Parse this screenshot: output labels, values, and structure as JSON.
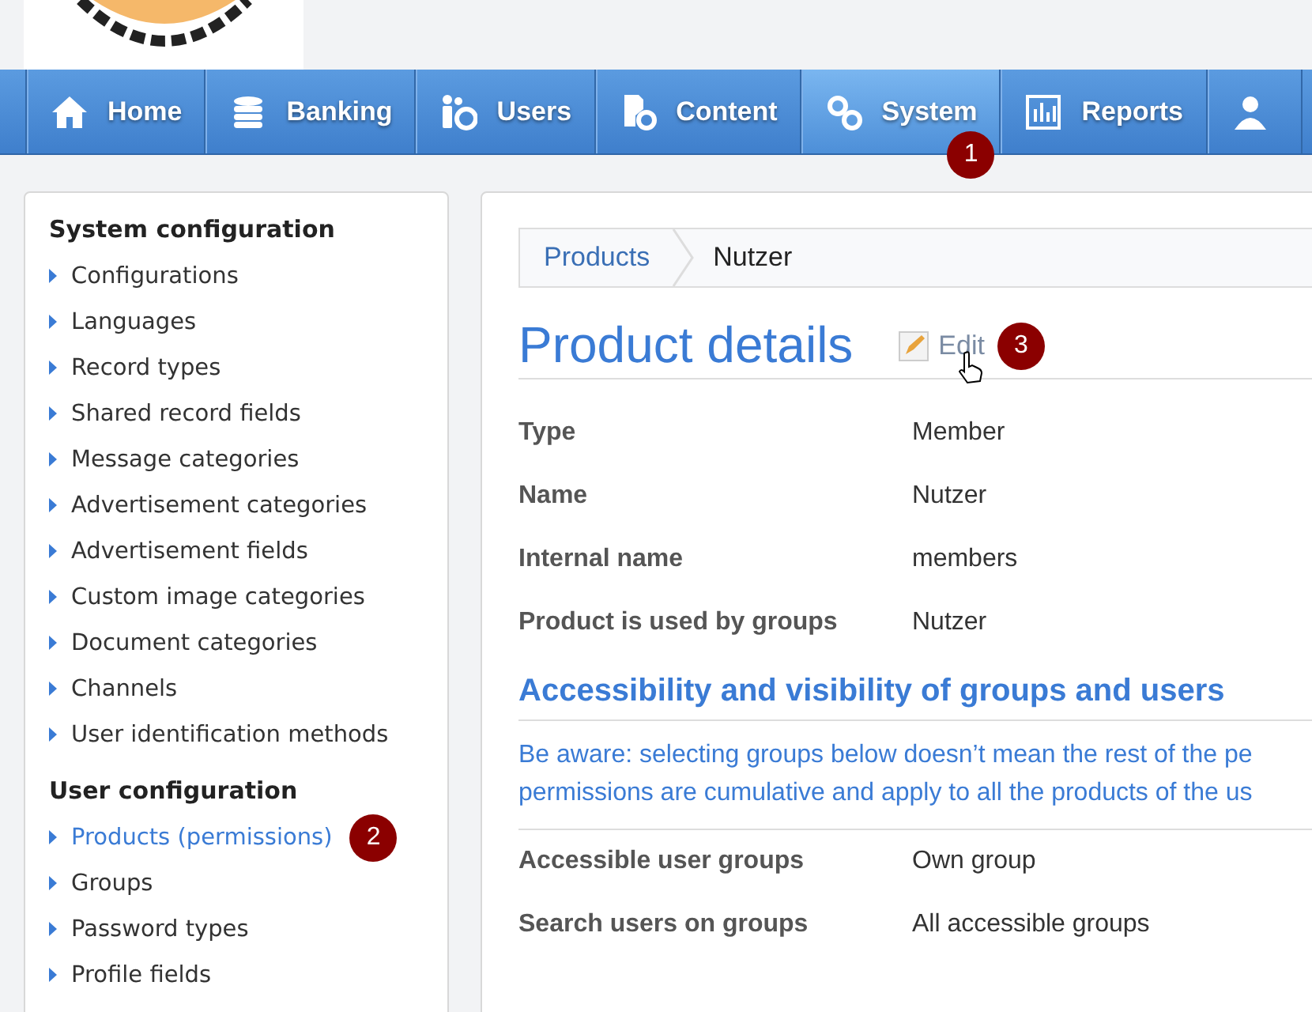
{
  "nav": [
    {
      "label": "Home",
      "selected": false
    },
    {
      "label": "Banking",
      "selected": false
    },
    {
      "label": "Users",
      "selected": false
    },
    {
      "label": "Content",
      "selected": false
    },
    {
      "label": "System",
      "selected": true,
      "badge": "1"
    },
    {
      "label": "Reports",
      "selected": false
    },
    {
      "selected": false
    }
  ],
  "sidebar": {
    "sections": [
      {
        "title": "System configuration",
        "items": [
          {
            "label": "Configurations",
            "selected": false
          },
          {
            "label": "Languages",
            "selected": false
          },
          {
            "label": "Record types",
            "selected": false
          },
          {
            "label": "Shared record fields",
            "selected": false
          },
          {
            "label": "Message categories",
            "selected": false
          },
          {
            "label": "Advertisement categories",
            "selected": false
          },
          {
            "label": "Advertisement fields",
            "selected": false
          },
          {
            "label": "Custom image categories",
            "selected": false
          },
          {
            "label": "Document categories",
            "selected": false
          },
          {
            "label": "Channels",
            "selected": false
          },
          {
            "label": "User identification methods",
            "selected": false
          }
        ]
      },
      {
        "title": "User configuration",
        "items": [
          {
            "label": "Products (permissions)",
            "selected": true,
            "badge": "2"
          },
          {
            "label": "Groups",
            "selected": false
          },
          {
            "label": "Password types",
            "selected": false
          },
          {
            "label": "Profile fields",
            "selected": false
          }
        ]
      }
    ]
  },
  "main": {
    "breadcrumb": [
      "Products",
      "Nutzer"
    ],
    "title": "Product details",
    "edit": {
      "label": "Edit",
      "badge": "3"
    },
    "fields": [
      {
        "label": "Type",
        "value": "Member"
      },
      {
        "label": "Name",
        "value": "Nutzer"
      },
      {
        "label": "Internal name",
        "value": "members"
      },
      {
        "label": "Product is used by groups",
        "value": "Nutzer"
      }
    ],
    "section": {
      "title": "Accessibility and visibility of groups and users",
      "notice": [
        "Be aware: selecting groups below doesn’t mean the rest of the pe",
        "permissions are cumulative and apply to all the products of the us"
      ],
      "fields": [
        {
          "label": "Accessible user groups",
          "value": "Own group"
        },
        {
          "label": "Search users on groups",
          "value": "All accessible groups"
        }
      ]
    }
  }
}
